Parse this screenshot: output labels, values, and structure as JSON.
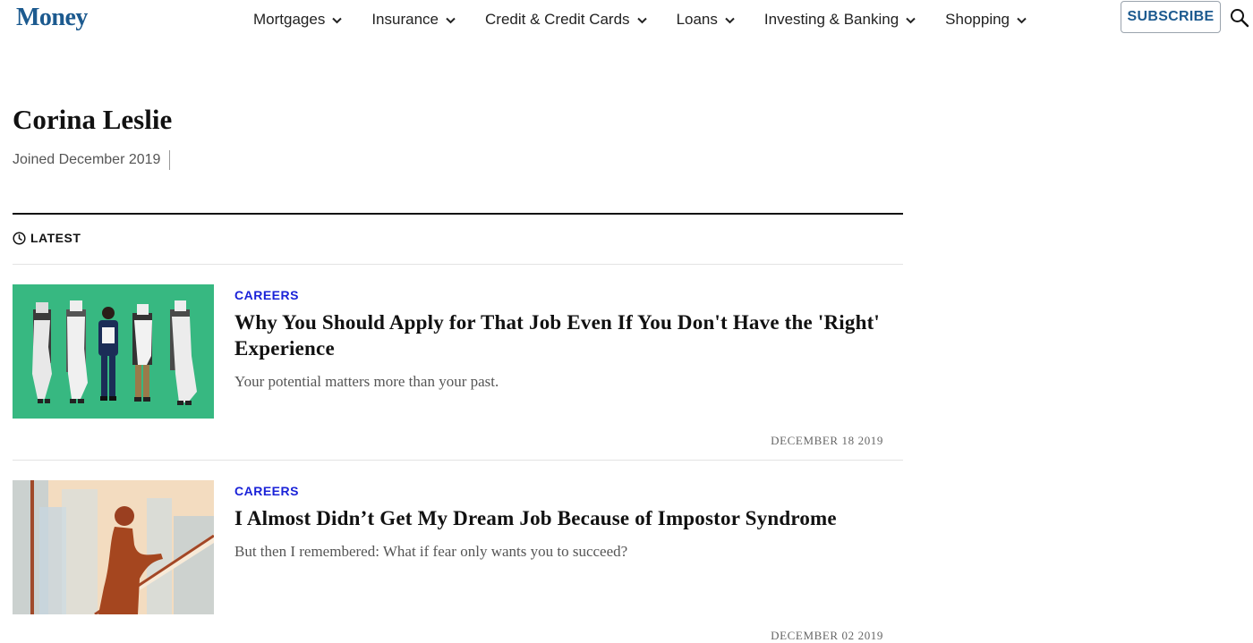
{
  "header": {
    "logo": "Money",
    "nav": [
      {
        "label": "Mortgages"
      },
      {
        "label": "Insurance"
      },
      {
        "label": "Credit & Credit Cards"
      },
      {
        "label": "Loans"
      },
      {
        "label": "Investing & Banking"
      },
      {
        "label": "Shopping"
      }
    ],
    "subscribe_label": "SUBSCRIBE",
    "brand_color": "#1c5a8f"
  },
  "author": {
    "name": "Corina Leslie",
    "joined": "Joined December 2019"
  },
  "latest_label": "LATEST",
  "articles": [
    {
      "category": "CAREERS",
      "title": "Why You Should Apply for That Job Even If You Don't Have the 'Right' Experience",
      "dek": "Your potential matters more than your past.",
      "date": "DECEMBER 18 2019"
    },
    {
      "category": "CAREERS",
      "title": "I Almost Didn’t Get My Dream Job Because of Impostor Syndrome",
      "dek": "But then I remembered: What if fear only wants you to succeed?",
      "date": "DECEMBER 02 2019"
    }
  ],
  "category_color": "#1a22d8"
}
